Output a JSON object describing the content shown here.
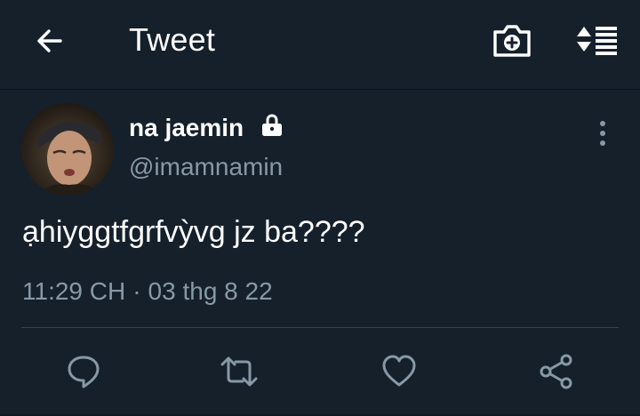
{
  "header": {
    "title": "Tweet",
    "back_icon": "arrow-left-icon",
    "camera_icon": "camera-add-icon",
    "sort_icon": "sort-list-icon"
  },
  "tweet": {
    "author_name": "na jaemin",
    "author_handle": "@imamnamin",
    "protected_icon": "lock-icon",
    "text": "ạhiyggtfgrfvỳvg jz ba????",
    "time": "11:29 CH",
    "date": "03 thg 8 22",
    "meta_separator": "·"
  },
  "actions": [
    {
      "icon": "reply-icon"
    },
    {
      "icon": "retweet-icon"
    },
    {
      "icon": "like-icon"
    },
    {
      "icon": "share-icon"
    }
  ],
  "colors": {
    "background": "#15202b",
    "text": "#ffffff",
    "secondary": "#8899a6",
    "divider": "#38444d"
  }
}
